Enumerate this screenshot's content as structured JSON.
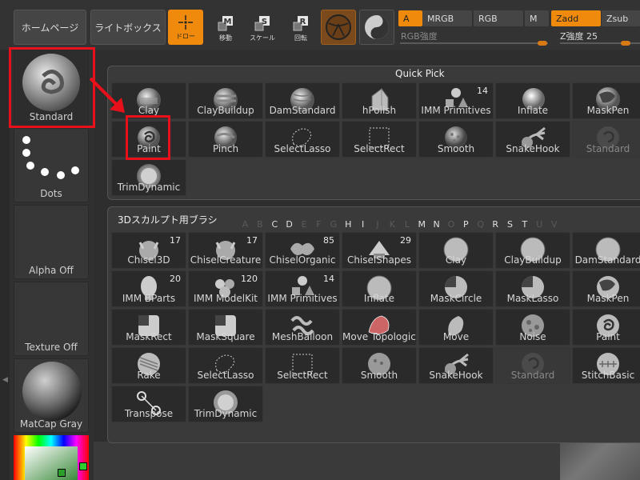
{
  "topbar": {
    "home": "ホームページ",
    "lightbox": "ライトボックス",
    "tools": [
      {
        "label": "ドロー",
        "glyph": "",
        "active": true
      },
      {
        "label": "移動",
        "glyph": "M"
      },
      {
        "label": "スケール",
        "glyph": "S"
      },
      {
        "label": "回転",
        "glyph": "R"
      }
    ],
    "modes": {
      "a": "A",
      "mrgb": "MRGB",
      "rgb": "RGB",
      "m": "M",
      "zadd": "Zadd",
      "zsub": "Zsub"
    },
    "rgb_intensity_label": "RGB強度",
    "z_intensity_label": "Z強度",
    "z_intensity_value": "25",
    "accent": "#f08a0c"
  },
  "sidebar": {
    "current_brush": "Standard",
    "stroke": "Dots",
    "alpha": "Alpha Off",
    "texture": "Texture Off",
    "material": "MatCap Gray"
  },
  "quick_pick": {
    "title": "Quick Pick",
    "cells": [
      {
        "label": "Clay"
      },
      {
        "label": "ClayBuildup"
      },
      {
        "label": "DamStandard"
      },
      {
        "label": "hPolish"
      },
      {
        "label": "IMM Primitives",
        "count": "14"
      },
      {
        "label": "Inflate"
      },
      {
        "label": "MaskPen"
      },
      {
        "label": "Paint"
      },
      {
        "label": "Pinch"
      },
      {
        "label": "SelectLasso"
      },
      {
        "label": "SelectRect"
      },
      {
        "label": "Smooth"
      },
      {
        "label": "SnakeHook"
      },
      {
        "label": "Standard"
      },
      {
        "label": "TrimDynamic"
      }
    ]
  },
  "brush_panel": {
    "title": "3Dスカルプト用ブラシ",
    "letters": [
      {
        "l": "A",
        "on": false
      },
      {
        "l": "B",
        "on": false
      },
      {
        "l": "C",
        "on": true
      },
      {
        "l": "D",
        "on": true
      },
      {
        "l": "E",
        "on": false
      },
      {
        "l": "F",
        "on": false
      },
      {
        "l": "G",
        "on": false
      },
      {
        "l": "H",
        "on": true
      },
      {
        "l": "I",
        "on": true
      },
      {
        "l": "J",
        "on": false
      },
      {
        "l": "K",
        "on": false
      },
      {
        "l": "L",
        "on": false
      },
      {
        "l": "M",
        "on": true
      },
      {
        "l": "N",
        "on": true
      },
      {
        "l": "O",
        "on": false
      },
      {
        "l": "P",
        "on": true
      },
      {
        "l": "Q",
        "on": false
      },
      {
        "l": "R",
        "on": true
      },
      {
        "l": "S",
        "on": true
      },
      {
        "l": "T",
        "on": true
      },
      {
        "l": "U",
        "on": false
      },
      {
        "l": "V",
        "on": false
      }
    ],
    "cells": [
      {
        "label": "Chisel3D",
        "count": "17"
      },
      {
        "label": "ChiselCreature",
        "count": "17"
      },
      {
        "label": "ChiselOrganic",
        "count": "85"
      },
      {
        "label": "ChiselShapes",
        "count": "29"
      },
      {
        "label": "Clay"
      },
      {
        "label": "ClayBuildup"
      },
      {
        "label": "DamStandard"
      },
      {
        "label": "IMM BParts",
        "count": "20"
      },
      {
        "label": "IMM ModelKit",
        "count": "120"
      },
      {
        "label": "IMM Primitives",
        "count": "14"
      },
      {
        "label": "Inflate"
      },
      {
        "label": "MaskCircle"
      },
      {
        "label": "MaskLasso"
      },
      {
        "label": "MaskPen"
      },
      {
        "label": "MaskRect"
      },
      {
        "label": "MaskSquare"
      },
      {
        "label": "MeshBalloon"
      },
      {
        "label": "Move Topological"
      },
      {
        "label": "Move"
      },
      {
        "label": "Noise"
      },
      {
        "label": "Paint"
      },
      {
        "label": "Rake"
      },
      {
        "label": "SelectLasso"
      },
      {
        "label": "SelectRect"
      },
      {
        "label": "Smooth"
      },
      {
        "label": "SnakeHook"
      },
      {
        "label": "Standard"
      },
      {
        "label": "StitchBasic"
      },
      {
        "label": "Transpose"
      },
      {
        "label": "TrimDynamic"
      }
    ]
  },
  "colors": {
    "highlight": "#e8101a",
    "accent": "#f08a0c"
  }
}
